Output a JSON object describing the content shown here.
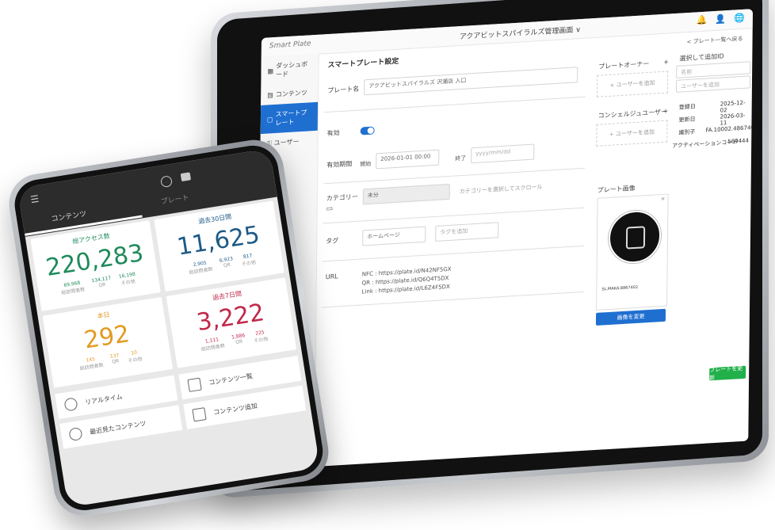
{
  "tablet": {
    "app_name": "Smart Plate",
    "window_title": "アクアビットスパイラルズ管理画面 ∨",
    "back_link": "< プレート一覧へ戻る",
    "sidebar": [
      {
        "label": "ダッシュボード"
      },
      {
        "label": "コンテンツ"
      },
      {
        "label": "スマートプレート"
      },
      {
        "label": "ユーザー"
      }
    ],
    "page_title": "スマートプレート設定",
    "form": {
      "plate_name_label": "プレート名",
      "plate_name_value": "アクアビットスパイラルズ 沢瀬店 入口",
      "enabled_label": "有効",
      "period_label": "有効期間",
      "start_label": "開始",
      "start_value": "2026-01-01 00:00",
      "end_label": "終了",
      "end_placeholder": "yyyy/mm/dd",
      "category_label": "カテゴリー",
      "category_value": "未分",
      "category_hint": "カテゴリーを選択してスクロール",
      "tag_label": "タグ",
      "tag_value": "ホームページ",
      "tag_placeholder": "タグを追加",
      "url_label": "URL",
      "url_nfc": "NFC : https://plate.id/N42NF5GX",
      "url_qr": "QR : https://plate.id/Q6Q4T5DX",
      "url_link": "Link : https://plate.id/L6Z4F5DX"
    },
    "right": {
      "owner_label": "プレートオーナー",
      "owner_add": "+ ユーザーを追加",
      "plus": "+",
      "concierge_label": "コンシェルジュユーザー",
      "concierge_add": "+ ユーザーを追加",
      "select_label": "選択して追加ID",
      "select_placeholder": "名前",
      "select_user": "ユーザーを追加",
      "registered_label": "登録日",
      "registered_value": "2025-12-02",
      "updated_label": "更新日",
      "updated_value": "2026-03-11",
      "identifier_label": "識別子",
      "identifier_value": "FA.10002.4867402",
      "activation_label": "アクティベーションコード",
      "activation_value": "569444",
      "plate_image_label": "プレート画像",
      "plate_caption": "SL.MAKA.8867402",
      "change_image_button": "画像を変更",
      "save_button": "プレートを更新"
    }
  },
  "phone": {
    "tab_contents": "コンテンツ",
    "tab_plate": "プレート",
    "stats": [
      {
        "title": "総アクセス数",
        "value": "220,283",
        "sub": [
          {
            "num": "69,968",
            "cap": "総訪問者数"
          },
          {
            "num": "134,117",
            "cap": "QR"
          },
          {
            "num": "16,198",
            "cap": "その他"
          }
        ]
      },
      {
        "title": "過去30日間",
        "value": "11,625",
        "sub": [
          {
            "num": "2,905",
            "cap": "総訪問者数"
          },
          {
            "num": "6,923",
            "cap": "QR"
          },
          {
            "num": "817",
            "cap": "その他"
          }
        ]
      },
      {
        "title": "本日",
        "value": "292",
        "sub": [
          {
            "num": "145",
            "cap": "総訪問者数"
          },
          {
            "num": "137",
            "cap": "QR"
          },
          {
            "num": "10",
            "cap": "その他"
          }
        ]
      },
      {
        "title": "過去7日間",
        "value": "3,222",
        "sub": [
          {
            "num": "1,111",
            "cap": "総訪問者数"
          },
          {
            "num": "1,886",
            "cap": "QR"
          },
          {
            "num": "225",
            "cap": "その他"
          }
        ]
      }
    ],
    "actions": [
      {
        "label": "リアルタイム"
      },
      {
        "label": "コンテンツ一覧"
      },
      {
        "label": "最近見たコンテンツ"
      },
      {
        "label": "コンテンツ追加"
      }
    ]
  }
}
